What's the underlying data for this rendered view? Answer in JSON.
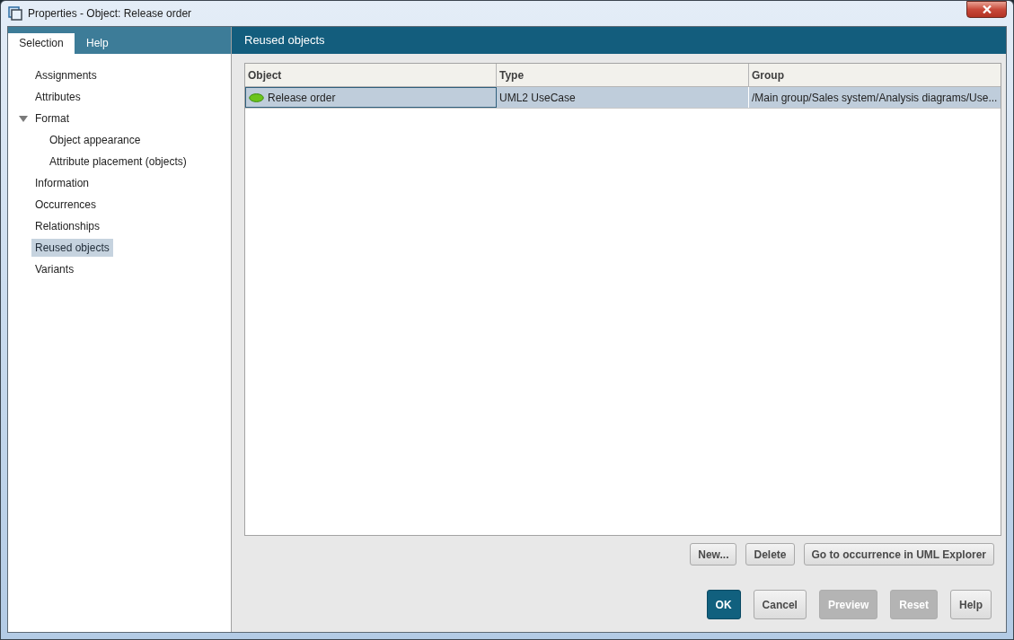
{
  "window": {
    "title": "Properties - Object: Release order"
  },
  "tabs": [
    {
      "label": "Selection",
      "selected": true
    },
    {
      "label": "Help",
      "selected": false
    }
  ],
  "navigation": {
    "items": [
      {
        "label": "Assignments",
        "selected": false
      },
      {
        "label": "Attributes",
        "selected": false
      },
      {
        "label": "Format",
        "selected": false,
        "expanded": true,
        "children": [
          {
            "label": "Object appearance",
            "selected": false
          },
          {
            "label": "Attribute placement (objects)",
            "selected": false
          }
        ]
      },
      {
        "label": "Information",
        "selected": false
      },
      {
        "label": "Occurrences",
        "selected": false
      },
      {
        "label": "Relationships",
        "selected": false
      },
      {
        "label": "Reused objects",
        "selected": true
      },
      {
        "label": "Variants",
        "selected": false
      }
    ]
  },
  "panel": {
    "title": "Reused objects",
    "table": {
      "columns": [
        "Object",
        "Type",
        "Group"
      ],
      "rows": [
        {
          "selected": true,
          "cells": [
            "Release order",
            "UML2 UseCase",
            "/Main group/Sales system/Analysis diagrams/Use..."
          ]
        }
      ]
    }
  },
  "action_buttons": [
    {
      "label": "New...",
      "disabled": false
    },
    {
      "label": "Delete",
      "disabled": false
    },
    {
      "label": "Go to occurrence in UML Explorer",
      "disabled": false
    }
  ],
  "dialog_buttons": [
    {
      "label": "OK",
      "default": true,
      "disabled": false
    },
    {
      "label": "Cancel",
      "default": false,
      "disabled": false
    },
    {
      "label": "Preview",
      "default": false,
      "disabled": true
    },
    {
      "label": "Reset",
      "default": false,
      "disabled": true
    },
    {
      "label": "Help",
      "default": false,
      "disabled": false
    }
  ]
}
